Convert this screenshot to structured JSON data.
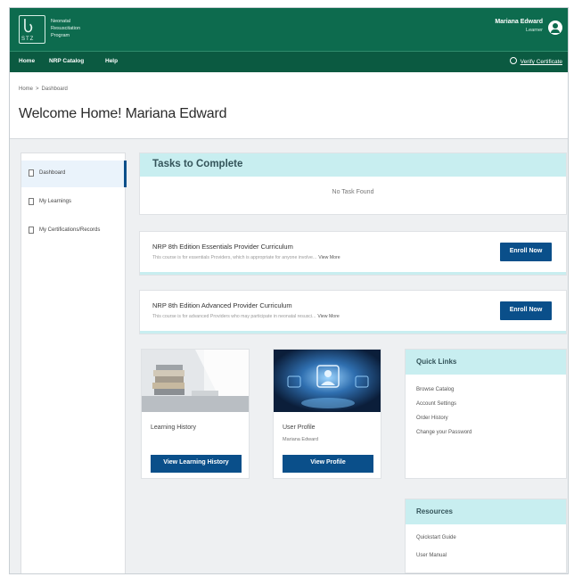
{
  "header": {
    "logo_mark": "Ⴑ",
    "logo_sub": "STZ",
    "org_lines": [
      "Neonatal",
      "Resuscitation",
      "Program"
    ],
    "user_name": "Mariana Edward",
    "user_role": "Learner"
  },
  "nav": {
    "items": [
      "Home",
      "NRP Catalog",
      "Help"
    ],
    "right_link": "Verify Certificate"
  },
  "breadcrumb": [
    "Home",
    "Dashboard"
  ],
  "page_title": "Welcome Home! Mariana Edward",
  "sidebar": {
    "items": [
      {
        "label": "Dashboard",
        "icon": "document-icon",
        "active": true
      },
      {
        "label": "My Learnings",
        "icon": "document-icon",
        "active": false
      },
      {
        "label": "My Certifications/Records",
        "icon": "document-icon",
        "active": false
      }
    ]
  },
  "tasks": {
    "title": "Tasks to Complete",
    "empty_text": "No Task Found"
  },
  "courses": [
    {
      "title": "NRP 8th Edition Essentials Provider Curriculum",
      "description": "This course is for essentials Providers, which is appropriate for anyone involve...",
      "view_more": "View More",
      "button": "Enroll Now"
    },
    {
      "title": "NRP 8th Edition Advanced Provider Curriculum",
      "description": "This course is for advanced Providers who may participate in neonatal resusci...",
      "view_more": "View More",
      "button": "Enroll Now"
    }
  ],
  "tiles": [
    {
      "title": "Learning History",
      "subtitle": "",
      "button": "View Learning History"
    },
    {
      "title": "User Profile",
      "subtitle": "Mariana Edward",
      "button": "View Profile"
    }
  ],
  "quick_links": {
    "title": "Quick Links",
    "links": [
      "Browse Catalog",
      "Account Settings",
      "Order History",
      "Change your Password"
    ]
  },
  "resources": {
    "title": "Resources",
    "links": [
      "Quickstart Guide",
      "User Manual"
    ]
  },
  "colors": {
    "header_green": "#0d6b4e",
    "nav_green": "#0b5a41",
    "accent_teal": "#c8eef0",
    "button_blue": "#0a4f8a"
  }
}
